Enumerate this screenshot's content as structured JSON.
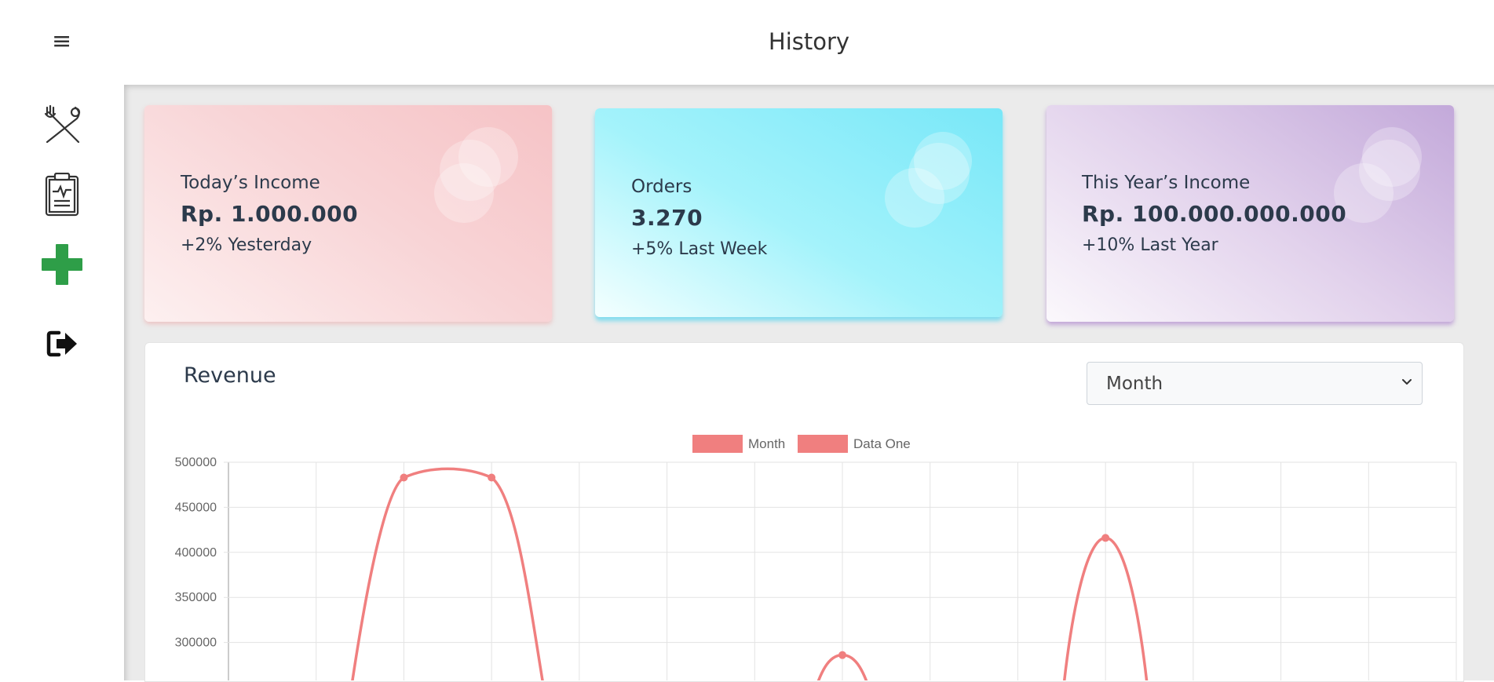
{
  "header": {
    "title": "History"
  },
  "sidebar": {
    "menu_icon": "≡",
    "items": [
      {
        "name": "menu-fork-knife-icon"
      },
      {
        "name": "clipboard-report-icon"
      },
      {
        "name": "add-plus-icon",
        "color": "#2e9e48"
      },
      {
        "name": "logout-icon"
      }
    ]
  },
  "cards": [
    {
      "label": "Today’s Income",
      "value": "Rp. 1.000.000",
      "sub": "+2% Yesterday"
    },
    {
      "label": "Orders",
      "value": "3.270",
      "sub": "+5% Last Week"
    },
    {
      "label": "This Year’s Income",
      "value": "Rp. 100.000.000.000",
      "sub": "+10% Last Year"
    }
  ],
  "revenue": {
    "title": "Revenue",
    "select": {
      "value": "Month"
    }
  },
  "chart_data": {
    "type": "line",
    "line_color": "#f07f7f",
    "legend": [
      {
        "name": "Month"
      },
      {
        "name": "Data One"
      }
    ],
    "legend_position": "top",
    "grid": true,
    "ylim": [
      250000,
      500000
    ],
    "y_ticks": [
      "500000",
      "450000",
      "400000",
      "350000",
      "300000"
    ],
    "x_count": 14,
    "points": [
      {
        "i": 2,
        "y": 483000
      },
      {
        "i": 3,
        "y": 483000
      },
      {
        "i": 7,
        "y": 286000
      },
      {
        "i": 10,
        "y": 416000
      }
    ]
  }
}
